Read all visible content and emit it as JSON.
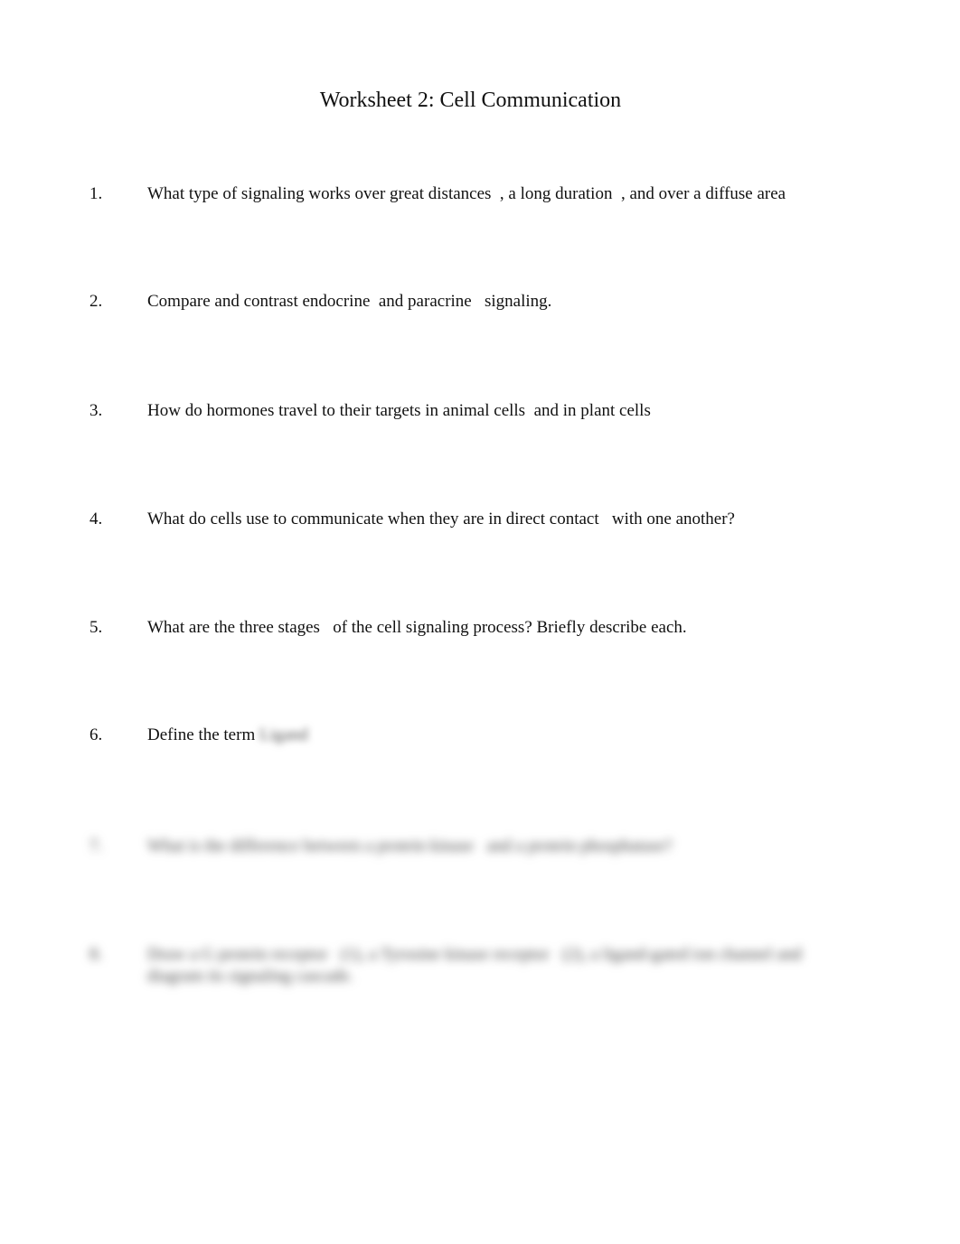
{
  "document": {
    "title": "Worksheet 2: Cell Communication",
    "questions": [
      {
        "number": "1.",
        "text": "What type of signaling works over great distances  , a long duration  , and over a diffuse area"
      },
      {
        "number": "2.",
        "text": "Compare and contrast endocrine  and paracrine   signaling."
      },
      {
        "number": "3.",
        "text": "How do hormones travel to their targets in animal cells  and in plant cells"
      },
      {
        "number": "4.",
        "text": "What do cells use to communicate when they are in direct contact   with one another?"
      },
      {
        "number": "5.",
        "text": "What are the three stages   of the cell signaling process? Briefly describe each."
      },
      {
        "number": "6.",
        "text": "Define the term ",
        "blurred_term": "Ligand"
      },
      {
        "number": "7.",
        "text": "What is the difference between a protein kinase   and a protein phosphatase?"
      },
      {
        "number": "8.",
        "text": "Draw a G protein receptor   (1), a Tyrosine kinase receptor   (2), a ligand-gated ion channel and diagram its signaling cascade."
      }
    ]
  }
}
